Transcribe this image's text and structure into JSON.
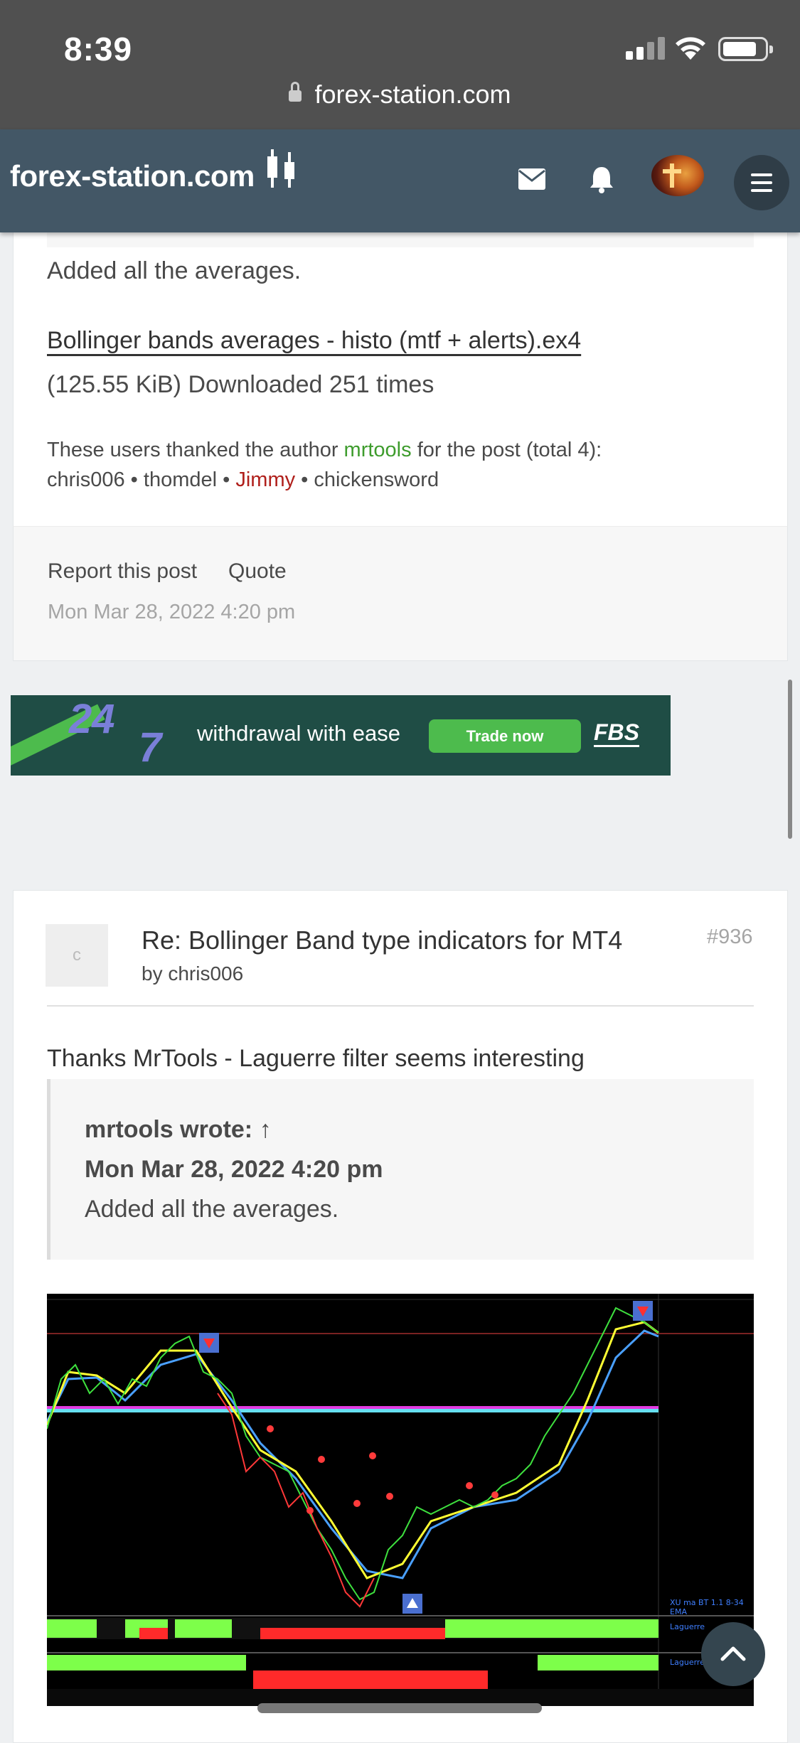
{
  "status_bar": {
    "time": "8:39",
    "url": "forex-station.com"
  },
  "navbar": {
    "logo": "forex-station.com",
    "icons": [
      "envelope-icon",
      "bell-icon",
      "user-avatar",
      "hamburger-menu-icon"
    ]
  },
  "post1": {
    "body_tail": "Added all the averages.",
    "attachment_name": "Bollinger bands averages - histo (mtf + alerts).ex4",
    "attachment_meta": "(125.55 KiB) Downloaded 251 times",
    "thanks_prefix": "These users thanked the author",
    "thanks_author": "mrtools",
    "thanks_suffix": "for the post (total 4):",
    "thanked_users": [
      "chris006",
      "thomdel",
      "Jimmy",
      "chickensword"
    ],
    "report_label": "Report this post",
    "quote_label": "Quote",
    "date": "Mon Mar 28, 2022 4:20 pm"
  },
  "banner": {
    "big_24": "24",
    "big_7": "7",
    "slogan": "withdrawal with ease",
    "button": "Trade now",
    "brand": "FBS"
  },
  "post2": {
    "avatar_letter": "c",
    "title": "Re: Bollinger Band type indicators for MT4",
    "by": "by chris006",
    "number": "#936",
    "body": "Thanks MrTools - Laguerre filter seems interesting",
    "quote_author": "mrtools wrote: ↑",
    "quote_date": "Mon Mar 28, 2022 4:20 pm",
    "quote_text": "Added all the averages."
  },
  "chart_image": {
    "right_labels": [
      "XU ma BT 1.1 8-34 EMA",
      "Laguerre",
      "Laguerre"
    ]
  },
  "colors": {
    "navbar": "#435766",
    "status_bar": "#505050",
    "link_green": "#3e9c2d",
    "user_red": "#b0201c",
    "banner_bg": "#1f4d45",
    "banner_green": "#4dbb4d"
  }
}
